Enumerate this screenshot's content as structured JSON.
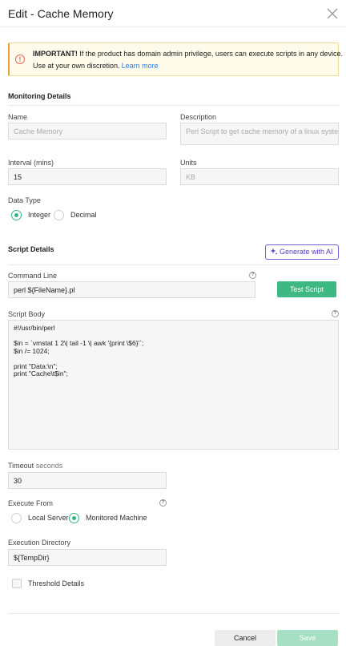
{
  "dialog": {
    "title": "Edit - Cache Memory"
  },
  "warning": {
    "bold": "IMPORTANT!",
    "text1": " If the product has domain admin privilege, users can execute scripts in any device.",
    "text2": "Use at your own discretion.",
    "link": "Learn more",
    "icon": "alert-circle-icon"
  },
  "monitoring": {
    "heading": "Monitoring Details",
    "name_label": "Name",
    "name_value": "Cache Memory",
    "description_label": "Description",
    "description_value": "Perl Script to get cache memory of a linux system",
    "interval_label": "Interval (mins)",
    "interval_value": "15",
    "units_label": "Units",
    "units_value": "KB",
    "datatype_label": "Data Type",
    "datatype_options": [
      "Integer",
      "Decimal"
    ],
    "datatype_selected": "Integer"
  },
  "script": {
    "heading": "Script Details",
    "ai_button": "Generate with AI",
    "command_label": "Command Line",
    "command_value": "perl ${FileName}.pl",
    "test_button": "Test Script",
    "body_label": "Script Body",
    "body_lines": [
      "#!/usr/bin/perl",
      "",
      "$in = `vmstat 1 2\\| tail -1 \\| awk '{print \\$6}'`;",
      "$in /= 1024;",
      "",
      "print \"Data:\\n\";",
      "print \"Cache\\t$in\";"
    ],
    "timeout_label": "Timeout",
    "timeout_unit": "seconds",
    "timeout_value": "30",
    "execute_from_label": "Execute From",
    "execute_from_options": [
      "Local Server",
      "Monitored Machine"
    ],
    "execute_from_selected": "Monitored Machine",
    "exec_dir_label": "Execution Directory",
    "exec_dir_value": "${TempDir}",
    "threshold_label": "Threshold Details"
  },
  "footer": {
    "cancel": "Cancel",
    "save": "Save"
  },
  "colors": {
    "accent_green": "#3fb984",
    "ai_purple": "#5b3cc4",
    "warning_bg": "#fffbea"
  }
}
